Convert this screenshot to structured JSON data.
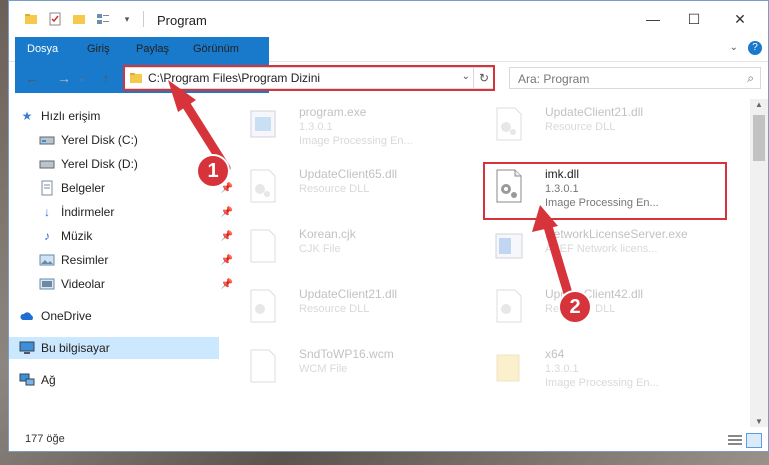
{
  "window": {
    "title": "Program"
  },
  "ribbon": {
    "tabs": [
      "Dosya",
      "Giriş",
      "Paylaş",
      "Görünüm"
    ]
  },
  "address": {
    "path": "C:\\Program Files\\Program Dizini"
  },
  "search": {
    "placeholder": "Ara: Program"
  },
  "sidebar": {
    "items": [
      {
        "label": "Hızlı erişim",
        "icon": "star-icon"
      },
      {
        "label": "Yerel Disk (C:)",
        "icon": "drive-icon"
      },
      {
        "label": "Yerel Disk (D:)",
        "icon": "drive-icon"
      },
      {
        "label": "Belgeler",
        "icon": "documents-icon"
      },
      {
        "label": "İndirmeler",
        "icon": "download-icon"
      },
      {
        "label": "Müzik",
        "icon": "music-icon"
      },
      {
        "label": "Resimler",
        "icon": "pictures-icon"
      },
      {
        "label": "Videolar",
        "icon": "videos-icon"
      },
      {
        "label": "OneDrive",
        "icon": "cloud-icon"
      },
      {
        "label": "Bu bilgisayar",
        "icon": "computer-icon"
      },
      {
        "label": "Ağ",
        "icon": "network-icon"
      }
    ]
  },
  "files": [
    {
      "name": "program.exe",
      "l2": "1.3.0.1",
      "l3": "Image Processing En..."
    },
    {
      "name": "UpdateClient21.dll",
      "l2": "Resource DLL",
      "l3": ""
    },
    {
      "name": "UpdateClient65.dll",
      "l2": "Resource DLL",
      "l3": ""
    },
    {
      "name": "imk.dll",
      "l2": "1.3.0.1",
      "l3": "Image Processing En..."
    },
    {
      "name": "Korean.cjk",
      "l2": "CJK File",
      "l3": ""
    },
    {
      "name": "NetworkLicenseServer.exe",
      "l2": "AXEF Network licens...",
      "l3": ""
    },
    {
      "name": "UpdateClient21.dll",
      "l2": "Resource DLL",
      "l3": ""
    },
    {
      "name": "UpdateClient42.dll",
      "l2": "Resource DLL",
      "l3": ""
    },
    {
      "name": "SndToWP16.wcm",
      "l2": "WCM File",
      "l3": ""
    },
    {
      "name": "x64",
      "l2": "1.3.0.1",
      "l3": "Image Processing En..."
    }
  ],
  "status": {
    "count": "177 öğe"
  },
  "annotations": {
    "one": "1",
    "two": "2"
  },
  "colors": {
    "accent": "#1979ca",
    "highlight": "#d6333b",
    "selected": "#cce8ff"
  }
}
